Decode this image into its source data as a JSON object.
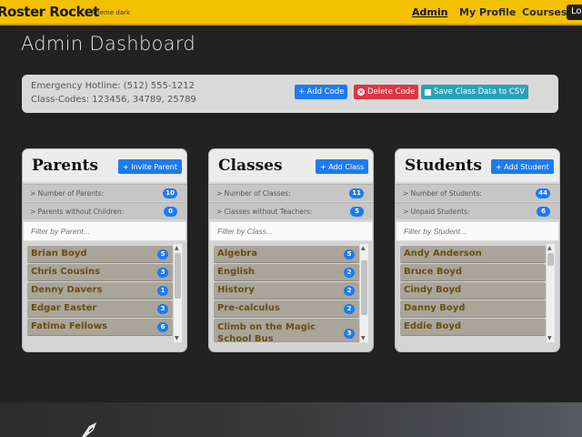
{
  "navbar": {
    "brand": "Roster Rocket",
    "theme_label": "Theme dark",
    "links": [
      "Admin",
      "My Profile",
      "Courses"
    ],
    "logout_label": "Log"
  },
  "page": {
    "title": "Admin Dashboard"
  },
  "info": {
    "hotline": "Emergency Hotline: (512) 555-1212",
    "codes": "Class-Codes: 123456, 34789, 25789",
    "add_code_label": "Add Code",
    "delete_code_label": "Delete Code",
    "save_csv_label": "Save Class Data to CSV"
  },
  "cards": {
    "parents": {
      "title": "Parents",
      "button_label": "Invite Parent",
      "stats": [
        {
          "label": "> Number of Parents:",
          "value": "10"
        },
        {
          "label": "> Parents without Children:",
          "value": "0"
        }
      ],
      "filter_placeholder": "Filter by Parent...",
      "items": [
        {
          "label": "Brian Boyd",
          "count": "5"
        },
        {
          "label": "Chris Cousins",
          "count": "3"
        },
        {
          "label": "Denny Davers",
          "count": "1"
        },
        {
          "label": "Edgar Easter",
          "count": "3"
        },
        {
          "label": "Fatima Fellows",
          "count": "6"
        }
      ]
    },
    "classes": {
      "title": "Classes",
      "button_label": "Add Class",
      "stats": [
        {
          "label": "> Number of Classes:",
          "value": "11"
        },
        {
          "label": "> Classes without Teachers:",
          "value": "5"
        }
      ],
      "filter_placeholder": "Filter by Class...",
      "items": [
        {
          "label": "Algebra",
          "count": "5"
        },
        {
          "label": "English",
          "count": "2"
        },
        {
          "label": "History",
          "count": "2"
        },
        {
          "label": "Pre-calculus",
          "count": "2"
        },
        {
          "label": "Climb on the Magic School Bus",
          "count": "3"
        }
      ]
    },
    "students": {
      "title": "Students",
      "button_label": "Add Student",
      "stats": [
        {
          "label": "> Number of Students:",
          "value": "44"
        },
        {
          "label": "> Unpaid Students:",
          "value": "6"
        }
      ],
      "filter_placeholder": "Filter by Student...",
      "items": [
        {
          "label": "Andy Anderson"
        },
        {
          "label": "Bruce Boyd"
        },
        {
          "label": "Cindy Boyd"
        },
        {
          "label": "Danny Boyd"
        },
        {
          "label": "Eddie Boyd"
        }
      ]
    }
  }
}
